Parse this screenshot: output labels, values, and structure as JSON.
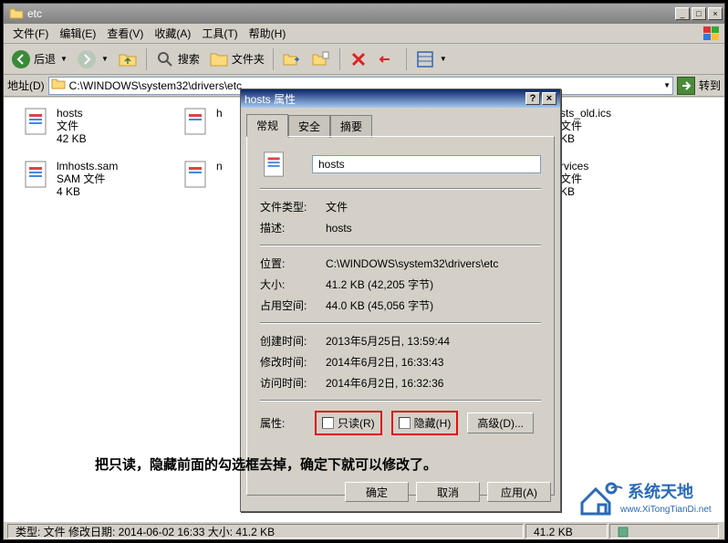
{
  "window": {
    "title": "etc",
    "minimize": "_",
    "maximize": "□",
    "close": "×"
  },
  "menu": {
    "items": [
      "文件(F)",
      "编辑(E)",
      "查看(V)",
      "收藏(A)",
      "工具(T)",
      "帮助(H)"
    ]
  },
  "toolbar": {
    "back": "后退",
    "search": "搜索",
    "folders": "文件夹"
  },
  "address": {
    "label": "地址(D)",
    "path": "C:\\WINDOWS\\system32\\drivers\\etc",
    "go": "转到"
  },
  "files": [
    {
      "name": "hosts",
      "type": "文件",
      "size": "42 KB"
    },
    {
      "name": "lmhosts.sam",
      "type": "SAM 文件",
      "size": "4 KB"
    },
    {
      "name": "h",
      "type": "",
      "size": ""
    },
    {
      "name": "n",
      "type": "",
      "size": ""
    },
    {
      "name": "sts_old.ics",
      "type": "文件",
      "size": "KB"
    },
    {
      "name": "rvices",
      "type": "文件",
      "size": "KB"
    }
  ],
  "dialog": {
    "title": "hosts 属性",
    "help": "?",
    "close": "×",
    "tabs": {
      "general": "常规",
      "security": "安全",
      "summary": "摘要"
    },
    "filename": "hosts",
    "rows": {
      "filetype_k": "文件类型:",
      "filetype_v": "文件",
      "desc_k": "描述:",
      "desc_v": "hosts",
      "location_k": "位置:",
      "location_v": "C:\\WINDOWS\\system32\\drivers\\etc",
      "size_k": "大小:",
      "size_v": "41.2 KB (42,205 字节)",
      "ondisk_k": "占用空间:",
      "ondisk_v": "44.0 KB (45,056 字节)",
      "created_k": "创建时间:",
      "created_v": "2013年5月25日, 13:59:44",
      "modified_k": "修改时间:",
      "modified_v": "2014年6月2日, 16:33:43",
      "accessed_k": "访问时间:",
      "accessed_v": "2014年6月2日, 16:32:36",
      "attr_k": "属性:"
    },
    "readonly": "只读(R)",
    "hidden": "隐藏(H)",
    "advanced": "高级(D)...",
    "ok": "确定",
    "cancel": "取消",
    "apply": "应用(A)"
  },
  "annotation": "把只读，隐藏前面的勾选框去掉，确定下就可以修改了。",
  "status": {
    "left": "类型: 文件 修改日期: 2014-06-02 16:33 大小: 41.2 KB",
    "right": "41.2 KB"
  },
  "watermark": {
    "brand": "系统天地",
    "url": "www.XiTongTianDi.net"
  }
}
